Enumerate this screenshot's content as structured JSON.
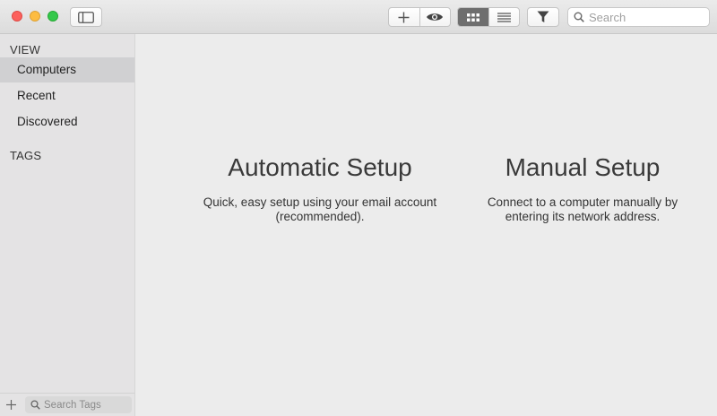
{
  "toolbar": {
    "search_placeholder": "Search"
  },
  "sidebar": {
    "view_header": "VIEW",
    "items": [
      {
        "label": "Computers",
        "selected": true
      },
      {
        "label": "Recent",
        "selected": false
      },
      {
        "label": "Discovered",
        "selected": false
      }
    ],
    "tags_header": "TAGS",
    "tag_search_placeholder": "Search Tags"
  },
  "main": {
    "automatic": {
      "title": "Automatic Setup",
      "desc_line1": "Quick, easy setup using your email account",
      "desc_line2": "(recommended)."
    },
    "manual": {
      "title": "Manual Setup",
      "desc_line1": "Connect to a computer manually by",
      "desc_line2": "entering its network address."
    }
  },
  "icons": {
    "sidebar_toggle": "sidebar-toggle-icon",
    "add": "plus-icon",
    "view": "eye-icon",
    "grid": "grid-icon",
    "list": "list-icon",
    "filter": "filter-icon",
    "search": "magnifier-icon"
  },
  "colors": {
    "close": "#fc605c",
    "minimize": "#fdbc40",
    "maximize": "#34c84a",
    "active_segment": "#6e6e6e"
  }
}
